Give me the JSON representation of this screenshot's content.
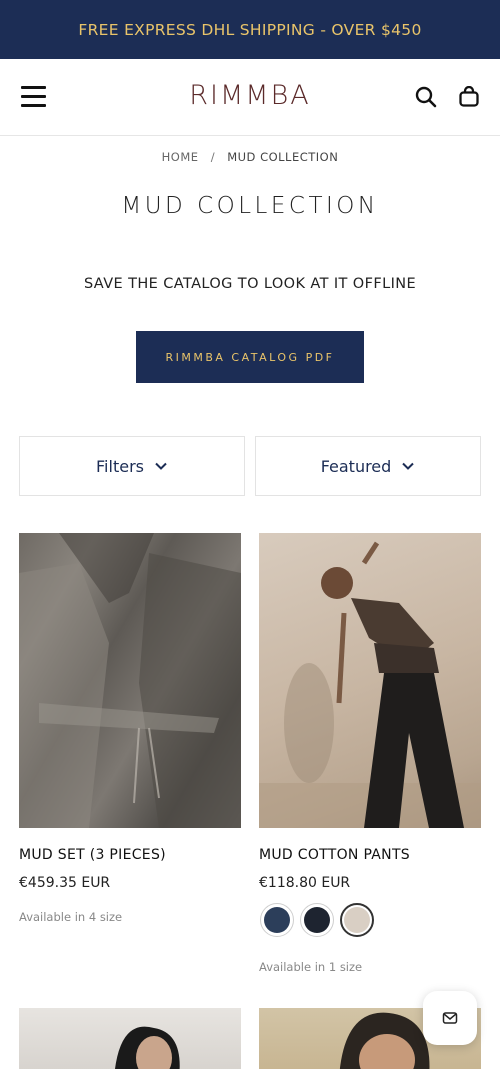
{
  "announcement": {
    "text": "FREE EXPRESS DHL SHIPPING - OVER $450"
  },
  "header": {
    "logo": "RIMMBA",
    "icons": {
      "menu": "hamburger-menu-icon",
      "search": "search-icon",
      "cart": "shopping-bag-icon"
    }
  },
  "breadcrumb": {
    "home": "HOME",
    "separator": "/",
    "current": "MUD COLLECTION"
  },
  "page": {
    "title": "MUD COLLECTION",
    "save_text": "SAVE THE CATALOG TO LOOK AT IT OFFLINE",
    "catalog_button": "RIMMBA CATALOG PDF"
  },
  "toolbar": {
    "filters_label": "Filters",
    "sort_label": "Featured"
  },
  "products": [
    {
      "name": "MUD SET (3 PIECES)",
      "price": "€459.35 EUR",
      "availability": "Available in 4 size"
    },
    {
      "name": "MUD COTTON PANTS",
      "price": "€118.80 EUR",
      "availability": "Available in 1 size",
      "swatches": [
        "#2c3e5a",
        "#1e2430",
        "#d9cfc4"
      ]
    }
  ],
  "colors": {
    "brand_navy": "#1c2d55",
    "accent_gold": "#e9c46a",
    "logo_maroon": "#5b2a2a"
  },
  "chat": {
    "icon": "mail-icon"
  }
}
